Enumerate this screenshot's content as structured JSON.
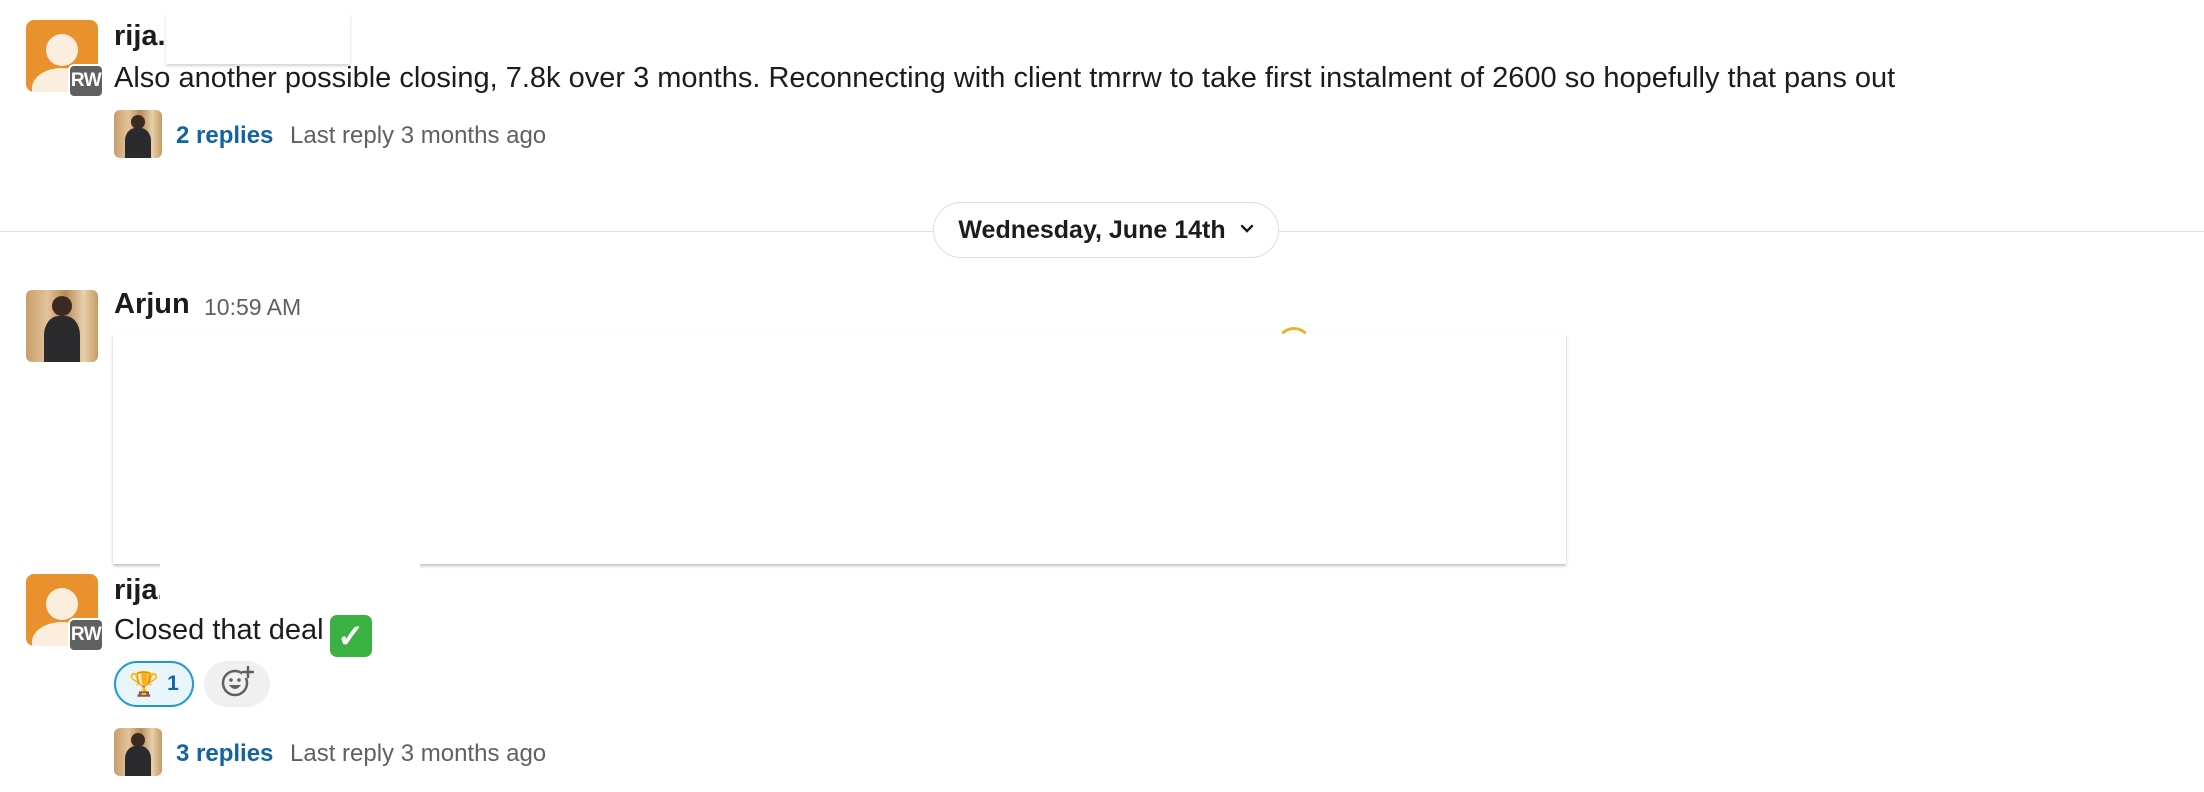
{
  "messages": [
    {
      "author": "rija.",
      "badge": "RW",
      "text": "Also another possible closing, 7.8k over 3 months. Reconnecting with client tmrrw to take first instalment of 2600 so hopefully that pans out",
      "thread": {
        "replies": "2 replies",
        "last_reply": "Last reply 3 months ago"
      }
    },
    {
      "author": "Arjun",
      "time": "10:59 AM"
    },
    {
      "author": "rija.",
      "badge": "RW",
      "text": "Closed that deal",
      "reactions": [
        {
          "emoji": "🏆",
          "count": "1"
        }
      ],
      "thread": {
        "replies": "3 replies",
        "last_reply": "Last reply 3 months ago"
      }
    }
  ],
  "date_divider": {
    "label": "Wednesday, June 14th"
  },
  "icons": {
    "chevron": "chevron-down-icon",
    "add_reaction": "add-reaction-icon",
    "check": "white-check-mark-emoji",
    "trophy": "trophy-emoji"
  },
  "colors": {
    "link": "#1264a3",
    "reaction_border": "#1d9bd1",
    "avatar_default": "#e8912d",
    "check_green": "#3bb143"
  }
}
